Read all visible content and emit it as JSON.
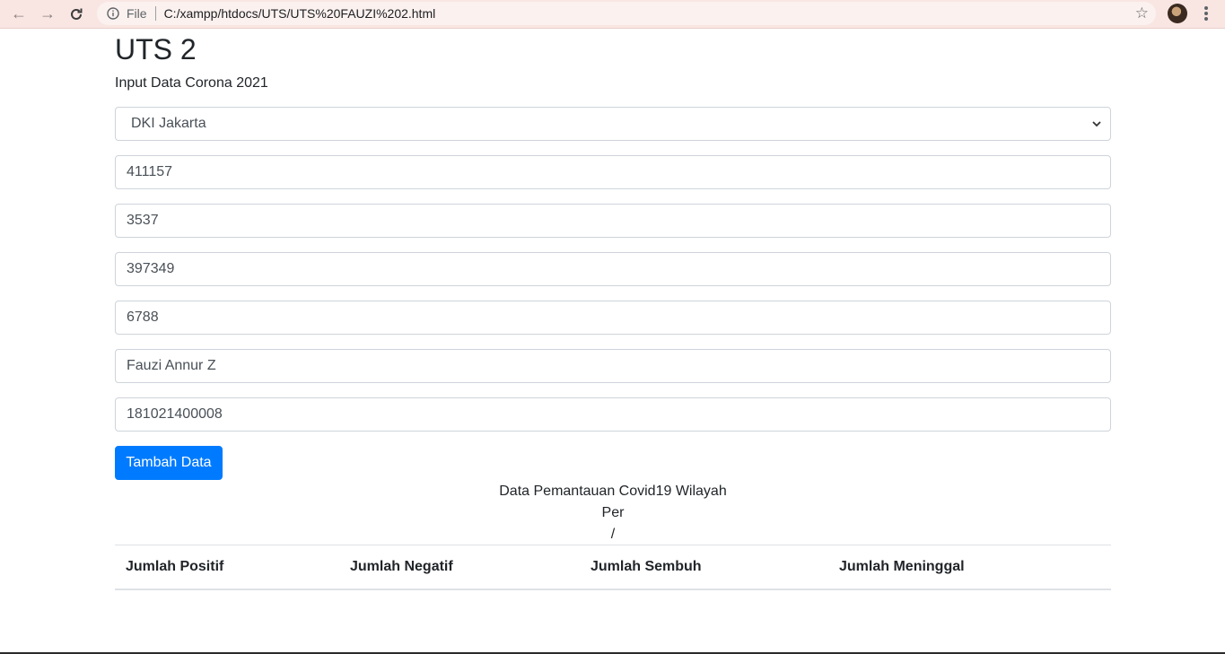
{
  "browser": {
    "scheme_label": "File",
    "url": "C:/xampp/htdocs/UTS/UTS%20FAUZI%202.html"
  },
  "page": {
    "title": "UTS 2",
    "subtitle": "Input Data Corona 2021",
    "region_select": {
      "selected": "DKI Jakarta"
    },
    "inputs": {
      "positif": "411157",
      "negatif": "3537",
      "sembuh": "397349",
      "meninggal": "6788",
      "nama": "Fauzi Annur Z",
      "nim": "181021400008"
    },
    "submit_label": "Tambah Data",
    "report": {
      "line1": "Data Pemantauan Covid19 Wilayah",
      "line2": "Per",
      "line3": "/"
    },
    "table": {
      "headers": [
        "Jumlah Positif",
        "Jumlah Negatif",
        "Jumlah Sembuh",
        "Jumlah Meninggal"
      ]
    }
  },
  "colors": {
    "primary": "#007bff",
    "chrome": "#f9e6e3"
  }
}
